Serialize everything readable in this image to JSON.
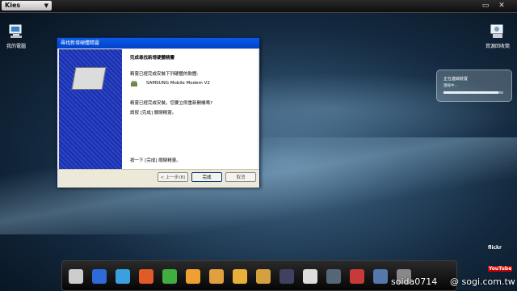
{
  "topbar": {
    "app_label": "Kies",
    "minimize": "▭",
    "close": "✕"
  },
  "desktop": {
    "left_icon_label": "我的電腦",
    "right_icon_label": "資源回收筒"
  },
  "dialog": {
    "title": "尋找新增硬體精靈",
    "heading": "完成尋找新增硬體精靈",
    "line1": "精靈已經完成安裝下列硬體的軟體:",
    "device": "SAMSUNG Mobile Modem V2",
    "line2": "精靈已經完成安裝，您要立即重新開機嗎?",
    "line3": "請按 [完成] 關閉精靈。",
    "footer_note": "按一下 [完成] 關閉精靈。",
    "back_btn": "< 上一步(B)",
    "finish_btn": "完成",
    "cancel_btn": "取消"
  },
  "notification": {
    "title": "正在連線裝置",
    "subtitle": "連線中...",
    "progress": 0.92
  },
  "side_logos": {
    "flickr": "flickr",
    "youtube": "YouTube"
  },
  "dock": {
    "icons": [
      "pen-icon",
      "calendar-grid-icon",
      "sailboat-icon",
      "phone-icon",
      "calendar-7-icon",
      "mail-icon",
      "notepad-icon",
      "photos-icon",
      "gallery-icon",
      "music-icon",
      "film-reel-icon",
      "video-icon",
      "store-icon",
      "globe-icon",
      "menu-icon"
    ],
    "colors": [
      "#cccccc",
      "#2e6bd6",
      "#3aa0e0",
      "#e05a2a",
      "#3fae3f",
      "#f0a030",
      "#e0a040",
      "#e8b038",
      "#d4a040",
      "#404060",
      "#dddddd",
      "#556677",
      "#c83a3a",
      "#5577aa",
      "#888888"
    ]
  },
  "watermark": {
    "user": "soida0714",
    "site": "@ sogi.com.tw"
  }
}
